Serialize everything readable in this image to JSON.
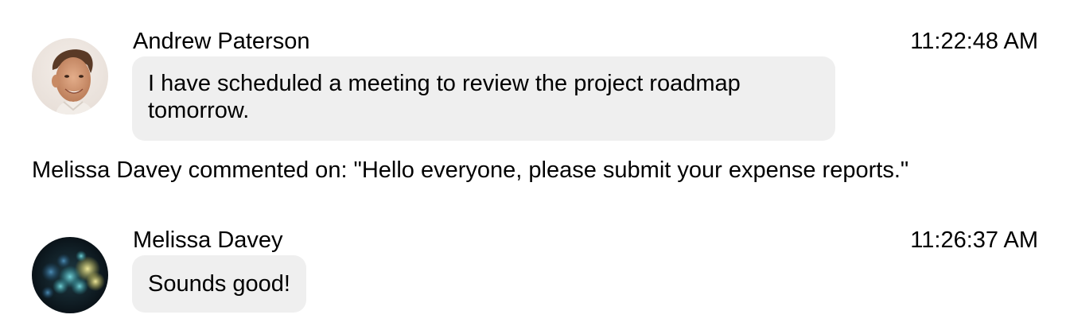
{
  "messages": [
    {
      "sender": "Andrew Paterson",
      "time": "11:22:48 AM",
      "text": "I have scheduled a meeting to review the project roadmap tomorrow.",
      "avatar_icon": "person-photo"
    },
    {
      "sender": "Melissa Davey",
      "time": "11:26:37 AM",
      "text": "Sounds good!",
      "avatar_icon": "bokeh-lights-photo"
    }
  ],
  "activity": {
    "text": "Melissa Davey commented on: \"Hello everyone, please submit your expense reports.\""
  },
  "colors": {
    "bubble_background": "#efefef",
    "text": "#000000"
  }
}
